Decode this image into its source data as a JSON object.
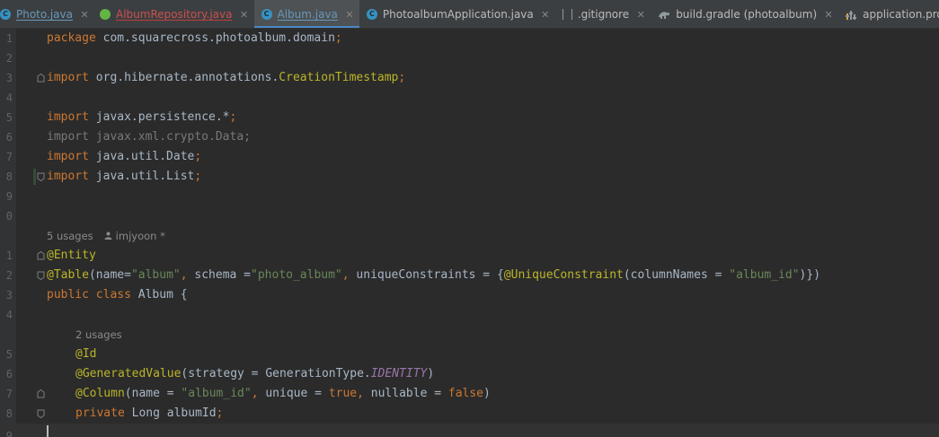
{
  "tabs": [
    {
      "label": "Photo.java",
      "icon": "class-icon",
      "style": "link",
      "active": false
    },
    {
      "label": "AlbumRepository.java",
      "icon": "interface-icon",
      "style": "err",
      "active": false
    },
    {
      "label": "Album.java",
      "icon": "class-icon",
      "style": "link",
      "active": true
    },
    {
      "label": "PhotoalbumApplication.java",
      "icon": "class-icon",
      "style": "",
      "active": false
    },
    {
      "label": ".gitignore",
      "icon": "file-icon",
      "style": "",
      "active": false
    },
    {
      "label": "build.gradle (photoalbum)",
      "icon": "gradle-icon",
      "style": "",
      "active": false
    },
    {
      "label": "application.properties",
      "icon": "properties-icon",
      "style": "",
      "active": false
    }
  ],
  "close_glyph": "✕",
  "class_icon_letter": "C",
  "line_numbers": [
    "1",
    "2",
    "3",
    "4",
    "5",
    "6",
    "7",
    "8",
    "9",
    "0",
    "1",
    "2",
    "3",
    "4",
    "5",
    "6",
    "7",
    "8",
    "9"
  ],
  "code": {
    "l1": {
      "kw": "package",
      "rest": " com.squarecross.photoalbum.domain",
      "semi": ";"
    },
    "l3": {
      "kw": "import",
      "rest": " org.hibernate.annotations.",
      "cls": "CreationTimestamp",
      "semi": ";"
    },
    "l5": {
      "kw": "import",
      "rest": " javax.persistence.*",
      "semi": ";"
    },
    "l6": {
      "text": "import javax.xml.crypto.Data;"
    },
    "l7": {
      "kw": "import",
      "rest": " java.util.Date",
      "semi": ";"
    },
    "l8": {
      "kw": "import",
      "rest": " java.util.List",
      "semi": ";"
    },
    "hint1": {
      "usages": "5 usages",
      "author": "imjyoon *"
    },
    "l12": {
      "ann": "@Entity"
    },
    "l13": {
      "ann": "@Table",
      "p1": "(name=",
      "s1": "\"album\"",
      "c1": ", ",
      "p2": "schema =",
      "s2": "\"photo_album\"",
      "c2": ", ",
      "p3": "uniqueConstraints = {",
      "ann2": "@UniqueConstraint",
      "p4": "(columnNames = ",
      "s3": "\"album_id\"",
      "p5": ")})"
    },
    "l14": {
      "kw1": "public",
      "kw2": "class",
      "name": " Album {"
    },
    "hint2": {
      "usages": "2 usages"
    },
    "l16": {
      "ann": "@Id"
    },
    "l17": {
      "ann": "@GeneratedValue",
      "p1": "(strategy = GenerationType.",
      "static": "IDENTITY",
      "p2": ")"
    },
    "l18": {
      "ann": "@Column",
      "p1": "(name = ",
      "s1": "\"album_id\"",
      "c1": ", ",
      "p2": "unique = ",
      "kw1": "true",
      "c2": ", ",
      "p3": "nullable = ",
      "kw2": "false",
      "p4": ")"
    },
    "l19": {
      "kw": "private",
      "rest": " Long albumId",
      "semi": ";"
    }
  },
  "colors": {
    "background": "#2b2b2b",
    "keyword": "#cc7832",
    "annotation": "#bbb529",
    "string": "#6a8759",
    "static_field": "#9876aa",
    "text": "#a9b7c6",
    "active_tab_underline": "#4a88c7"
  }
}
